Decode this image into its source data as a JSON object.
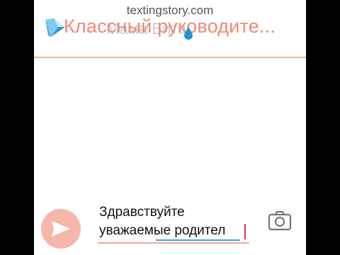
{
  "watermark": "textingstory.com",
  "header": {
    "title": "Классный руководите...",
    "title_echo": "Мама Вита"
  },
  "composer": {
    "draft_text": "Здравствуйте\nуважаемые родител",
    "send_icon": "send-icon",
    "camera_icon": "camera-icon"
  },
  "colors": {
    "accent": "#ee8a78",
    "divider": "#f1b3a7",
    "send_bg": "#f6b6aa",
    "cursor": "#d6336c"
  }
}
